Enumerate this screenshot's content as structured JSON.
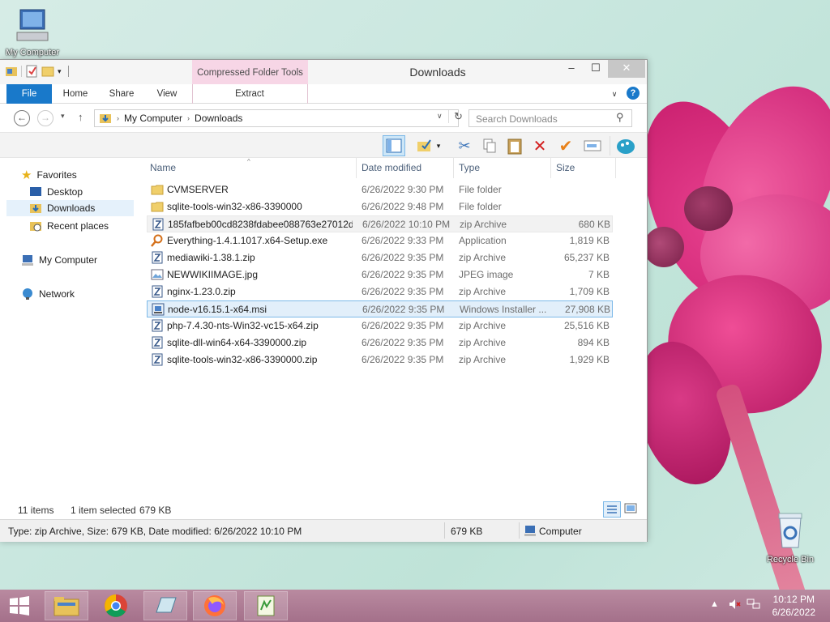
{
  "desktop": {
    "icons": [
      {
        "label": "My Computer"
      },
      {
        "label": "Recycle Bin"
      }
    ]
  },
  "window": {
    "title": "Downloads",
    "contextual_tab_group": "Compressed Folder Tools",
    "tabs": [
      "File",
      "Home",
      "Share",
      "View",
      "Extract"
    ],
    "help": "?",
    "address": {
      "segments": [
        "My Computer",
        "Downloads"
      ]
    },
    "search": {
      "placeholder": "Search Downloads"
    },
    "nav": {
      "favorites": "Favorites",
      "desktop": "Desktop",
      "downloads": "Downloads",
      "recent": "Recent places",
      "computer": "My Computer",
      "network": "Network"
    },
    "columns": {
      "name": "Name",
      "date": "Date modified",
      "type": "Type",
      "size": "Size"
    },
    "files": [
      {
        "name": "CVMSERVER",
        "date": "6/26/2022 9:30 PM",
        "type": "File folder",
        "size": "",
        "icon": "folder-icon"
      },
      {
        "name": "sqlite-tools-win32-x86-3390000",
        "date": "6/26/2022 9:48 PM",
        "type": "File folder",
        "size": "",
        "icon": "folder-icon"
      },
      {
        "name": "185fafbeb00cd8238fdabee088763e27012d...",
        "date": "6/26/2022 10:10 PM",
        "type": "zip Archive",
        "size": "680 KB",
        "icon": "zip-icon"
      },
      {
        "name": "Everything-1.4.1.1017.x64-Setup.exe",
        "date": "6/26/2022 9:33 PM",
        "type": "Application",
        "size": "1,819 KB",
        "icon": "search-app-icon"
      },
      {
        "name": "mediawiki-1.38.1.zip",
        "date": "6/26/2022 9:35 PM",
        "type": "zip Archive",
        "size": "65,237 KB",
        "icon": "zip-icon"
      },
      {
        "name": "NEWWIKIIMAGE.jpg",
        "date": "6/26/2022 9:35 PM",
        "type": "JPEG image",
        "size": "7 KB",
        "icon": "image-icon"
      },
      {
        "name": "nginx-1.23.0.zip",
        "date": "6/26/2022 9:35 PM",
        "type": "zip Archive",
        "size": "1,709 KB",
        "icon": "zip-icon"
      },
      {
        "name": "node-v16.15.1-x64.msi",
        "date": "6/26/2022 9:35 PM",
        "type": "Windows Installer ...",
        "size": "27,908 KB",
        "icon": "installer-icon"
      },
      {
        "name": "php-7.4.30-nts-Win32-vc15-x64.zip",
        "date": "6/26/2022 9:35 PM",
        "type": "zip Archive",
        "size": "25,516 KB",
        "icon": "zip-icon"
      },
      {
        "name": "sqlite-dll-win64-x64-3390000.zip",
        "date": "6/26/2022 9:35 PM",
        "type": "zip Archive",
        "size": "894 KB",
        "icon": "zip-icon"
      },
      {
        "name": "sqlite-tools-win32-x86-3390000.zip",
        "date": "6/26/2022 9:35 PM",
        "type": "zip Archive",
        "size": "1,929 KB",
        "icon": "zip-icon"
      }
    ],
    "status": {
      "items": "11 items",
      "selected": "1 item selected",
      "selected_size": "679 KB"
    },
    "details_bar": {
      "info": "Type: zip Archive, Size: 679 KB, Date modified: 6/26/2022 10:10 PM",
      "size": "679 KB",
      "location": "Computer"
    }
  },
  "taskbar": {
    "time": "10:12 PM",
    "date": "6/26/2022"
  },
  "colors": {
    "accent": "#1979ca",
    "context_tab": "#f7d6e6",
    "taskbar": "#b07a94",
    "selection": "#e2effa"
  }
}
